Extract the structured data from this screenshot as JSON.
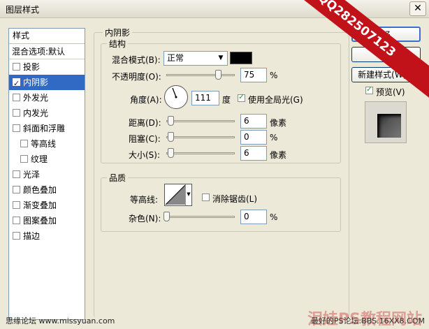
{
  "window": {
    "title": "图层样式",
    "close_glyph": "✕"
  },
  "styles_panel": {
    "header": "样式",
    "blend_options": "混合选项:默认",
    "items": [
      {
        "label": "投影",
        "checked": false,
        "sub": false,
        "selected": false
      },
      {
        "label": "内阴影",
        "checked": true,
        "sub": false,
        "selected": true
      },
      {
        "label": "外发光",
        "checked": false,
        "sub": false,
        "selected": false
      },
      {
        "label": "内发光",
        "checked": false,
        "sub": false,
        "selected": false
      },
      {
        "label": "斜面和浮雕",
        "checked": false,
        "sub": false,
        "selected": false
      },
      {
        "label": "等高线",
        "checked": false,
        "sub": true,
        "selected": false
      },
      {
        "label": "纹理",
        "checked": false,
        "sub": true,
        "selected": false
      },
      {
        "label": "光泽",
        "checked": false,
        "sub": false,
        "selected": false
      },
      {
        "label": "颜色叠加",
        "checked": false,
        "sub": false,
        "selected": false
      },
      {
        "label": "渐变叠加",
        "checked": false,
        "sub": false,
        "selected": false
      },
      {
        "label": "图案叠加",
        "checked": false,
        "sub": false,
        "selected": false
      },
      {
        "label": "描边",
        "checked": false,
        "sub": false,
        "selected": false
      }
    ]
  },
  "inner_shadow": {
    "section_title": "内阴影",
    "structure": {
      "title": "结构",
      "blend_mode_label": "混合模式(B):",
      "blend_mode_value": "正常",
      "blend_color": "#000000",
      "opacity_label": "不透明度(O):",
      "opacity_value": "75",
      "opacity_unit": "%",
      "angle_label": "角度(A):",
      "angle_value": "111",
      "angle_unit": "度",
      "global_light_label": "使用全局光(G)",
      "global_light_checked": true,
      "distance_label": "距离(D):",
      "distance_value": "6",
      "distance_unit": "像素",
      "choke_label": "阻塞(C):",
      "choke_value": "0",
      "choke_unit": "%",
      "size_label": "大小(S):",
      "size_value": "6",
      "size_unit": "像素"
    },
    "quality": {
      "title": "品质",
      "contour_label": "等高线:",
      "antialias_label": "消除锯齿(L)",
      "antialias_checked": false,
      "noise_label": "杂色(N):",
      "noise_value": "0",
      "noise_unit": "%"
    }
  },
  "buttons": {
    "ok": "好",
    "cancel": "取消",
    "new_style": "新建样式(W)...",
    "preview_label": "预览(V)",
    "preview_checked": true
  },
  "watermark": {
    "band_text": "泪娃PS教程QQ282507123",
    "bottom_text": "泪娃PS教程网站"
  },
  "footer": {
    "left": "思缘论坛  www.missyuan.com",
    "right": "最好的PS论坛:BBS.16XX8.COM"
  }
}
